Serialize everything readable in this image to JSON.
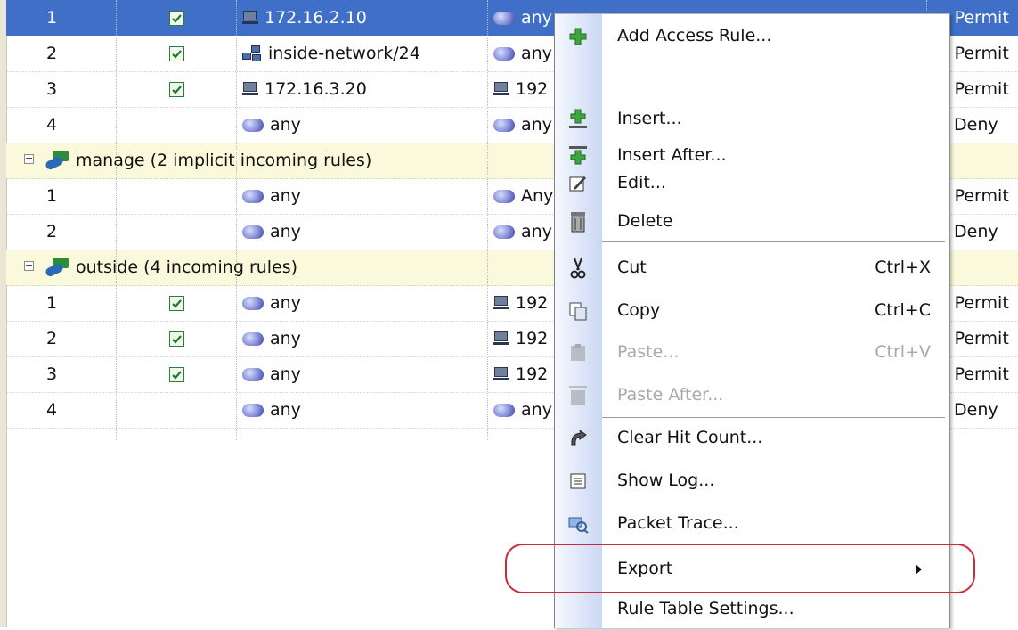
{
  "rows": [
    {
      "num": "1",
      "checked": true,
      "src_icon": "host-icon",
      "src": "172.16.2.10",
      "dst_icon": "network-object-icon",
      "dst": "any",
      "action": "Permit",
      "action_type": "permit",
      "selected": true
    },
    {
      "num": "2",
      "checked": true,
      "src_icon": "network-icon",
      "src": "inside-network/24",
      "dst_icon": "cloud-icon",
      "dst": "any",
      "action": "Permit",
      "action_type": "permit"
    },
    {
      "num": "3",
      "checked": true,
      "src_icon": "host-icon",
      "src": "172.16.3.20",
      "dst_icon": "host-icon",
      "dst": "192",
      "action": "Permit",
      "action_type": "permit"
    },
    {
      "num": "4",
      "checked": false,
      "src_icon": "cloud-icon",
      "src": "any",
      "dst_icon": "cloud-icon",
      "dst": "any",
      "action": "Deny",
      "action_type": "deny"
    },
    {
      "group": true,
      "label": "manage (2 implicit incoming rules)"
    },
    {
      "num": "1",
      "checked": false,
      "src_icon": "cloud-icon",
      "src": "any",
      "dst_icon": "cloud-icon",
      "dst": "Any",
      "action": "Permit",
      "action_type": "permit"
    },
    {
      "num": "2",
      "checked": false,
      "src_icon": "cloud-icon",
      "src": "any",
      "dst_icon": "cloud-icon",
      "dst": "any",
      "action": "Deny",
      "action_type": "deny"
    },
    {
      "group": true,
      "label": "outside (4 incoming rules)"
    },
    {
      "num": "1",
      "checked": true,
      "src_icon": "cloud-icon",
      "src": "any",
      "dst_icon": "host-icon",
      "dst": "192",
      "action": "Permit",
      "action_type": "permit"
    },
    {
      "num": "2",
      "checked": true,
      "src_icon": "cloud-icon",
      "src": "any",
      "dst_icon": "host-icon",
      "dst": "192",
      "action": "Permit",
      "action_type": "permit"
    },
    {
      "num": "3",
      "checked": true,
      "src_icon": "cloud-icon",
      "src": "any",
      "dst_icon": "host-icon",
      "dst": "192",
      "action": "Permit",
      "action_type": "permit"
    },
    {
      "num": "4",
      "checked": false,
      "src_icon": "cloud-icon",
      "src": "any",
      "dst_icon": "cloud-icon",
      "dst": "any",
      "action": "Deny",
      "action_type": "deny"
    }
  ],
  "context_menu": {
    "items": [
      {
        "key": "add",
        "label": "Add Access Rule...",
        "icon": "add-rule-icon"
      },
      {
        "key": "insert",
        "label": "Insert...",
        "icon": "insert-icon"
      },
      {
        "key": "insert_after",
        "label": "Insert After...",
        "icon": "insert-after-icon"
      },
      {
        "key": "edit",
        "label": "Edit...",
        "icon": "edit-icon"
      },
      {
        "key": "delete",
        "label": "Delete",
        "icon": "trash-icon"
      },
      {
        "key": "cut",
        "label": "Cut",
        "shortcut": "Ctrl+X",
        "icon": "scissors-icon"
      },
      {
        "key": "copy",
        "label": "Copy",
        "shortcut": "Ctrl+C",
        "icon": "copy-icon"
      },
      {
        "key": "paste",
        "label": "Paste...",
        "shortcut": "Ctrl+V",
        "icon": "paste-icon",
        "disabled": true
      },
      {
        "key": "paste_after",
        "label": "Paste After...",
        "icon": "paste-after-icon",
        "disabled": true
      },
      {
        "key": "clear_hit",
        "label": "Clear Hit Count...",
        "icon": "clear-hit-count-icon"
      },
      {
        "key": "show_log",
        "label": "Show Log...",
        "icon": "log-icon"
      },
      {
        "key": "packet_trace",
        "label": "Packet Trace...",
        "icon": "packet-trace-icon"
      },
      {
        "key": "export",
        "label": "Export",
        "icon": "",
        "submenu": true
      },
      {
        "key": "settings",
        "label": "Rule Table Settings...",
        "icon": ""
      }
    ]
  },
  "colors": {
    "selection": "#3f6fc7",
    "group_row": "#fbf9dc",
    "highlight": "#cc2a3a"
  }
}
